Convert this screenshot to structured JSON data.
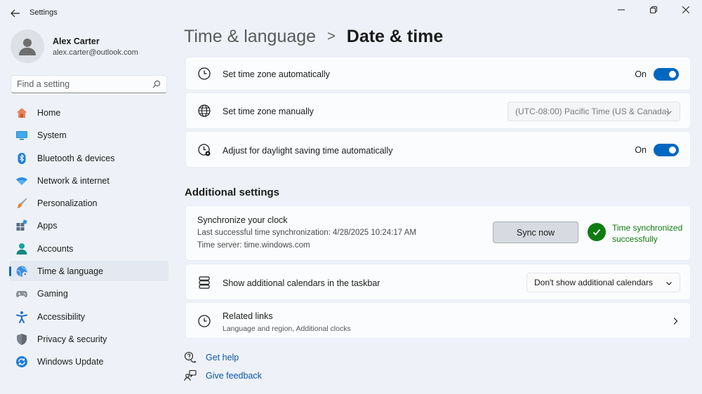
{
  "window": {
    "title": "Settings"
  },
  "profile": {
    "name": "Alex Carter",
    "email": "alex.carter@outlook.com"
  },
  "search": {
    "placeholder": "Find a setting"
  },
  "sidebar": {
    "items": [
      {
        "label": "Home",
        "icon": "home-icon"
      },
      {
        "label": "System",
        "icon": "system-icon"
      },
      {
        "label": "Bluetooth & devices",
        "icon": "bluetooth-icon"
      },
      {
        "label": "Network & internet",
        "icon": "wifi-icon"
      },
      {
        "label": "Personalization",
        "icon": "brush-icon"
      },
      {
        "label": "Apps",
        "icon": "apps-icon"
      },
      {
        "label": "Accounts",
        "icon": "accounts-icon"
      },
      {
        "label": "Time & language",
        "icon": "globe-clock-icon",
        "active": true
      },
      {
        "label": "Gaming",
        "icon": "gamepad-icon"
      },
      {
        "label": "Accessibility",
        "icon": "accessibility-icon"
      },
      {
        "label": "Privacy & security",
        "icon": "shield-icon"
      },
      {
        "label": "Windows Update",
        "icon": "update-icon"
      }
    ]
  },
  "header": {
    "parent": "Time & language",
    "separator": ">",
    "current": "Date & time"
  },
  "settings": {
    "auto_timezone": {
      "label": "Set time zone automatically",
      "state": "On"
    },
    "manual_timezone": {
      "label": "Set time zone manually",
      "value": "(UTC-08:00) Pacific Time (US & Canada)"
    },
    "daylight": {
      "label": "Adjust for daylight saving time automatically",
      "state": "On"
    }
  },
  "additional": {
    "title": "Additional settings",
    "sync": {
      "title": "Synchronize your clock",
      "last_sync": "Last successful time synchronization: 4/28/2025 10:24:17 AM",
      "server": "Time server: time.windows.com",
      "button": "Sync now",
      "status": "Time synchronized successfully"
    },
    "calendars": {
      "label": "Show additional calendars in the taskbar",
      "value": "Don't show additional calendars"
    },
    "related": {
      "title": "Related links",
      "subtitle": "Language and region, Additional clocks"
    }
  },
  "help": {
    "get_help": "Get help",
    "give_feedback": "Give feedback"
  },
  "colors": {
    "accent": "#0067c0",
    "success": "#107c10",
    "link": "#0a56a8",
    "background": "#eef2f8"
  }
}
